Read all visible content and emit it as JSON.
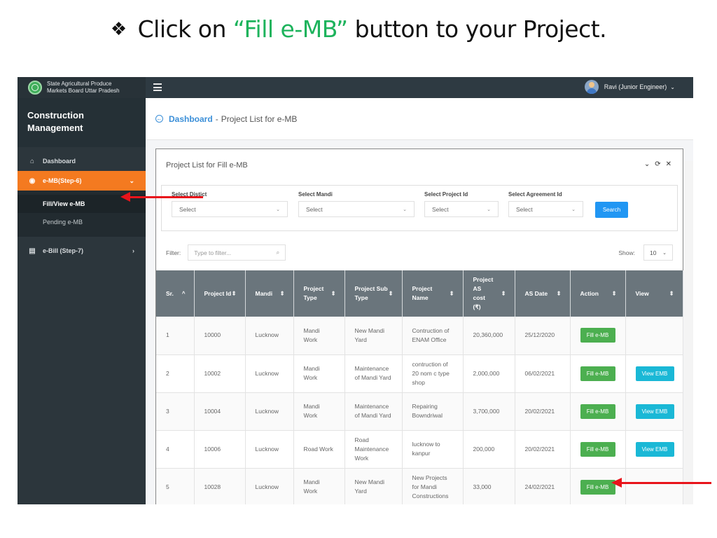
{
  "slide": {
    "bullet_icon": "❖",
    "title_prefix": "Click on ",
    "title_highlight": "“Fill e-MB”",
    "title_suffix": " button to your Project.",
    "highlight_color": "#1db35c"
  },
  "topbar": {
    "brand_line1": "State Agricultural Produce",
    "brand_line2": "Markets Board Uttar Pradesh",
    "user_label": "Ravi (Junior Engineer)",
    "user_chevron": "⌄"
  },
  "sidebar": {
    "title_line1": "Construction",
    "title_line2": "Management",
    "items": [
      {
        "label": "Dashboard",
        "icon": "home-icon",
        "glyph": "⌂"
      },
      {
        "label": "e-MB(Step-6)",
        "icon": "target-icon",
        "glyph": "◉",
        "arrow": "⌄",
        "active": true,
        "children": [
          {
            "label": "Fill/View e-MB",
            "current": true
          },
          {
            "label": "Pending e-MB"
          }
        ]
      },
      {
        "label": "e-Bill (Step-7)",
        "icon": "clipboard-icon",
        "glyph": "▤",
        "arrow": "›"
      }
    ],
    "accent_color": "#f47a20"
  },
  "breadcrumb": {
    "back_icon": "←",
    "link": "Dashboard",
    "separator": "-",
    "current": "Project List for e-MB"
  },
  "panel": {
    "title": "Project List for Fill e-MB",
    "tools": {
      "collapse": "⌄",
      "refresh": "⟳",
      "close": "✕"
    },
    "filters": [
      {
        "label": "Select Distict",
        "value": "Select"
      },
      {
        "label": "Select Mandi",
        "value": "Select"
      },
      {
        "label": "Select Project Id",
        "value": "Select"
      },
      {
        "label": "Select Agreement Id",
        "value": "Select"
      }
    ],
    "search_label": "Search",
    "filter_label": "Filter:",
    "filter_placeholder": "Type to filter...",
    "show_label": "Show:",
    "show_value": "10"
  },
  "table": {
    "columns": [
      {
        "label": "Sr.",
        "sort": "^"
      },
      {
        "label": "Project Id",
        "sort": "⇕"
      },
      {
        "label": "Mandi",
        "sort": "⇕"
      },
      {
        "label": "Project Type",
        "sort": "⇕"
      },
      {
        "label": "Project Sub Type",
        "sort": "⇕"
      },
      {
        "label": "Project Name",
        "sort": "⇕"
      },
      {
        "label": "Project AS cost (₹)",
        "sort": "⇕"
      },
      {
        "label": "AS Date",
        "sort": "⇕"
      },
      {
        "label": "Action",
        "sort": "⇕"
      },
      {
        "label": "View",
        "sort": "⇕"
      }
    ],
    "rows": [
      {
        "sr": "1",
        "project_id": "10000",
        "mandi": "Lucknow",
        "type": "Mandi Work",
        "sub_type": "New Mandi Yard",
        "name": "Contruction of ENAM Office",
        "cost": "20,360,000",
        "date": "25/12/2020",
        "action": "Fill e-MB",
        "view": ""
      },
      {
        "sr": "2",
        "project_id": "10002",
        "mandi": "Lucknow",
        "type": "Mandi Work",
        "sub_type": "Maintenance of Mandi Yard",
        "name": "contruction of 20 nom c type shop",
        "cost": "2,000,000",
        "date": "06/02/2021",
        "action": "Fill e-MB",
        "view": "View EMB"
      },
      {
        "sr": "3",
        "project_id": "10004",
        "mandi": "Lucknow",
        "type": "Mandi Work",
        "sub_type": "Maintenance of Mandi Yard",
        "name": "Repairing Bowndriwal",
        "cost": "3,700,000",
        "date": "20/02/2021",
        "action": "Fill e-MB",
        "view": "View EMB"
      },
      {
        "sr": "4",
        "project_id": "10006",
        "mandi": "Lucknow",
        "type": "Road Work",
        "sub_type": "Road Maintenance Work",
        "name": "lucknow to kanpur",
        "cost": "200,000",
        "date": "20/02/2021",
        "action": "Fill e-MB",
        "view": "View EMB"
      },
      {
        "sr": "5",
        "project_id": "10028",
        "mandi": "Lucknow",
        "type": "Mandi Work",
        "sub_type": "New Mandi Yard",
        "name": "New Projects for Mandi Constructions",
        "cost": "33,000",
        "date": "24/02/2021",
        "action": "Fill e-MB",
        "view": ""
      }
    ],
    "fill_color": "#4caf50",
    "view_color": "#1ab8d6"
  },
  "annotations": {
    "arrow_color": "#e8141b"
  }
}
